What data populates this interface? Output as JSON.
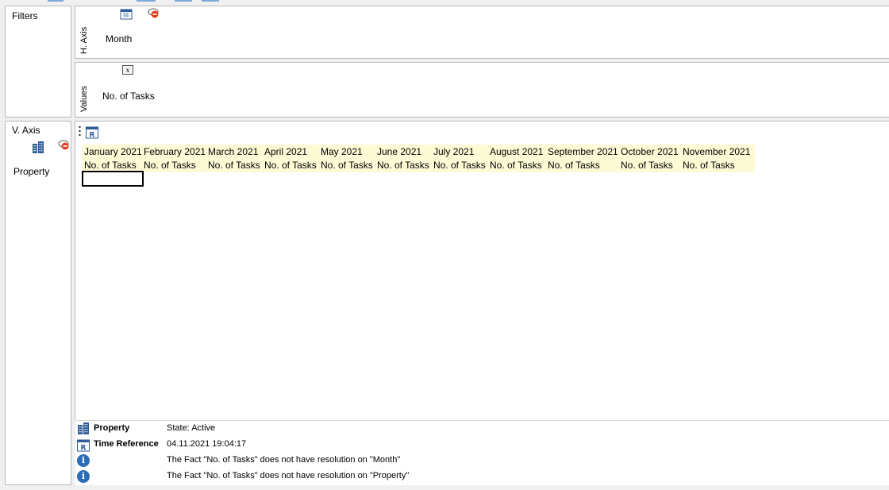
{
  "filters": {
    "label": "Filters"
  },
  "h_axis": {
    "label": "H. Axis",
    "item": "Month",
    "item_icon": "calendar-icon",
    "remove_icon": "remove-icon"
  },
  "values": {
    "label": "Values",
    "item": "No. of Tasks",
    "item_icon": "formula-icon"
  },
  "v_axis": {
    "label": "V. Axis",
    "item": "Property",
    "item_icon": "building-icon",
    "remove_icon": "remove-icon"
  },
  "grid": {
    "columns": [
      {
        "month": "January 2021",
        "measure": "No. of Tasks"
      },
      {
        "month": "February 2021",
        "measure": "No. of Tasks"
      },
      {
        "month": "March 2021",
        "measure": "No. of Tasks"
      },
      {
        "month": "April 2021",
        "measure": "No. of Tasks"
      },
      {
        "month": "May 2021",
        "measure": "No. of Tasks"
      },
      {
        "month": "June 2021",
        "measure": "No. of Tasks"
      },
      {
        "month": "July 2021",
        "measure": "No. of Tasks"
      },
      {
        "month": "August 2021",
        "measure": "No. of Tasks"
      },
      {
        "month": "September 2021",
        "measure": "No. of Tasks"
      },
      {
        "month": "October 2021",
        "measure": "No. of Tasks"
      },
      {
        "month": "November 2021",
        "measure": "No. of Tasks"
      }
    ],
    "header_color": "#fdfbd6"
  },
  "status": {
    "rows": [
      {
        "icon": "building-icon",
        "name": "Property",
        "value": "State: Active"
      },
      {
        "icon": "calendar-icon",
        "name": "Time Reference",
        "value": "04.11.2021 19:04:17"
      },
      {
        "icon": "info-icon",
        "name": "",
        "value": "The Fact \"No. of Tasks\" does not have resolution on \"Month\""
      },
      {
        "icon": "info-icon",
        "name": "",
        "value": "The Fact \"No. of Tasks\" does not have resolution on \"Property\""
      }
    ]
  }
}
